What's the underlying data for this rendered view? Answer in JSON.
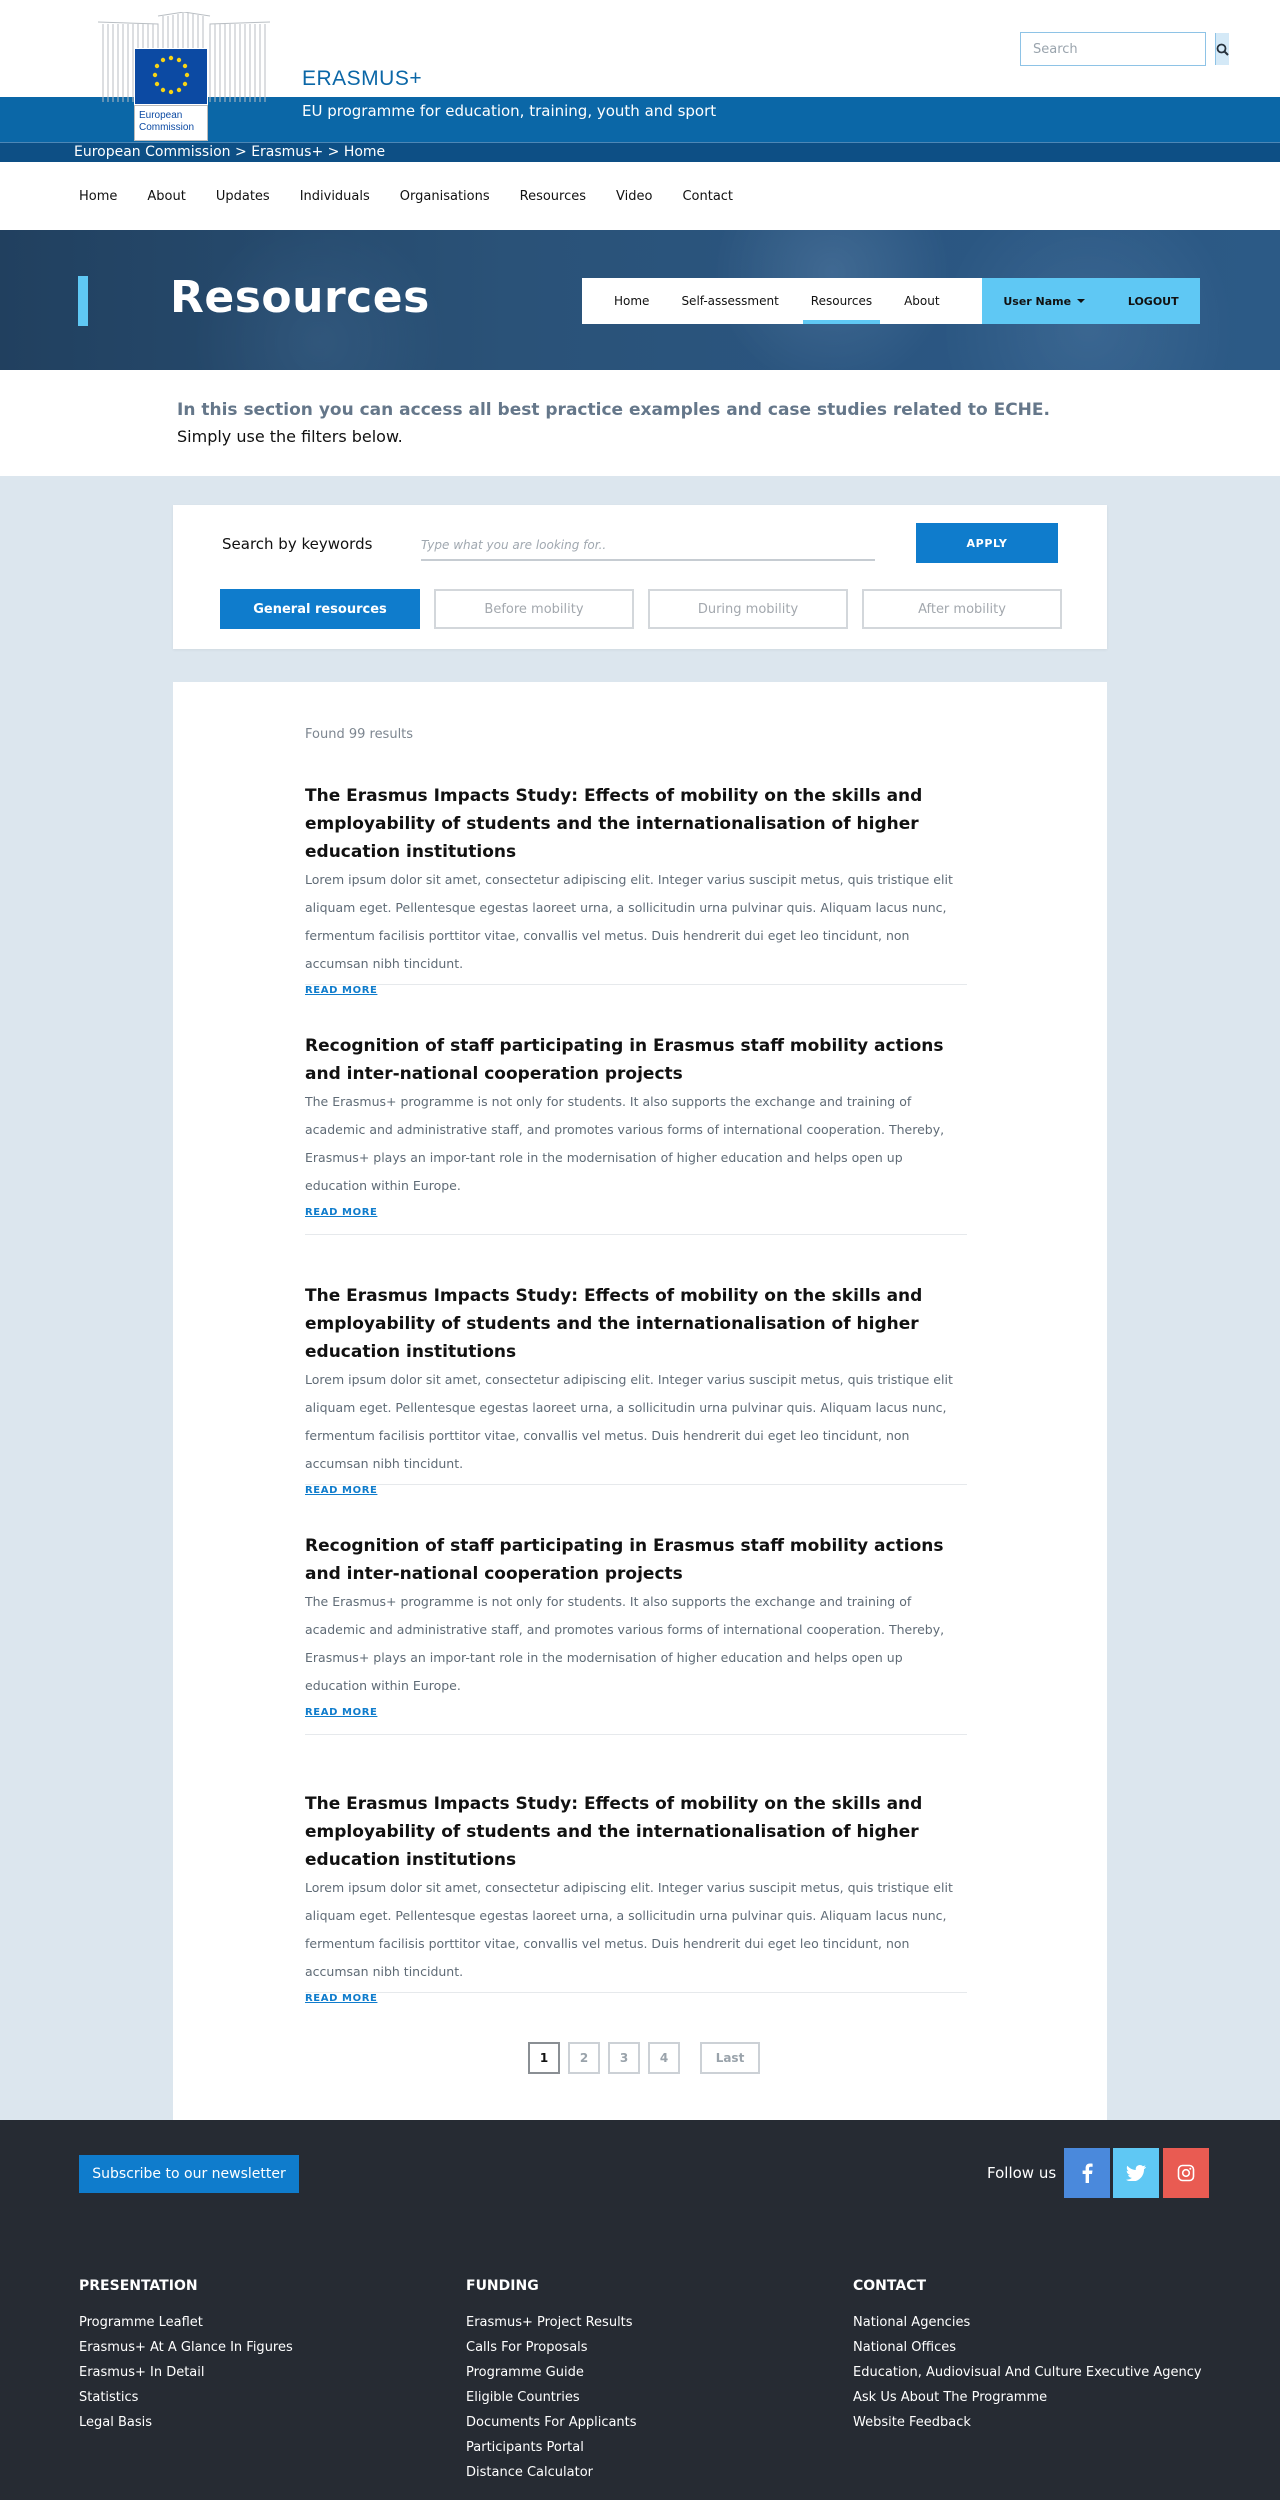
{
  "header": {
    "site_name": "ERASMUS+",
    "tagline": "EU programme for education, training, youth and sport",
    "logo_text": "European Commission",
    "search_placeholder": "Search",
    "breadcrumb": "European Commission > Erasmus+ > Home",
    "brand_blue": "#0b67a7"
  },
  "main_nav": [
    "Home",
    "About",
    "Updates",
    "Individuals",
    "Organisations",
    "Resources",
    "Video",
    "Contact"
  ],
  "hero": {
    "title": "Resources",
    "tabs": [
      "Home",
      "Self-assessment",
      "Resources",
      "About"
    ],
    "active_tab": "Resources",
    "user_name": "User Name",
    "logout": "LOGOUT",
    "accent": "#5fc8f4"
  },
  "intro": {
    "line1": "In this section you can access all best practice examples and case studies related to ECHE.",
    "line2": "Simply use the filters below."
  },
  "filters": {
    "label": "Search by keywords",
    "placeholder": "Type what you are looking for..",
    "apply": "APPLY",
    "tabs": [
      "General resources",
      "Before mobility",
      "During mobility",
      "After mobility"
    ],
    "active_tab": "General resources"
  },
  "results": {
    "found": "Found 99 results",
    "read_more": "READ MORE",
    "items": [
      {
        "title": "The Erasmus Impacts Study: Effects of mobility on the skills and employability of students and the internationalisation of higher education institutions",
        "text": "Lorem ipsum dolor sit amet, consectetur adipiscing elit. Integer varius suscipit metus, quis tristique elit aliquam eget. Pellentesque egestas laoreet urna, a sollicitudin urna pulvinar quis. Aliquam lacus nunc, fermentum facilisis porttitor vitae, convallis vel metus. Duis hendrerit dui eget leo tincidunt, non accumsan nibh tincidunt."
      },
      {
        "title": "Recognition of staff participating in Erasmus staff mobility actions and inter-national cooperation projects",
        "text": "The Erasmus+ programme is not only for students. It also supports the exchange and training of academic and administrative staff, and promotes various forms of international cooperation. Thereby, Erasmus+ plays an impor-tant role in the modernisation of higher education and helps open up education within Europe."
      },
      {
        "title": "The Erasmus Impacts Study: Effects of mobility on the skills and employability of students and the internationalisation of higher education institutions",
        "text": "Lorem ipsum dolor sit amet, consectetur adipiscing elit. Integer varius suscipit metus, quis tristique elit aliquam eget. Pellentesque egestas laoreet urna, a sollicitudin urna pulvinar quis. Aliquam lacus nunc, fermentum facilisis porttitor vitae, convallis vel metus. Duis hendrerit dui eget leo tincidunt, non accumsan nibh tincidunt."
      },
      {
        "title": "Recognition of staff participating in Erasmus staff mobility actions and inter-national cooperation projects",
        "text": "The Erasmus+ programme is not only for students. It also supports the exchange and training of academic and administrative staff, and promotes various forms of international cooperation. Thereby, Erasmus+ plays an impor-tant role in the modernisation of higher education and helps open up education within Europe."
      },
      {
        "title": "The Erasmus Impacts Study: Effects of mobility on the skills and employability of students and the internationalisation of higher education institutions",
        "text": "Lorem ipsum dolor sit amet, consectetur adipiscing elit. Integer varius suscipit metus, quis tristique elit aliquam eget. Pellentesque egestas laoreet urna, a sollicitudin urna pulvinar quis. Aliquam lacus nunc, fermentum facilisis porttitor vitae, convallis vel metus. Duis hendrerit dui eget leo tincidunt, non accumsan nibh tincidunt."
      }
    ]
  },
  "pagination": {
    "pages": [
      "1",
      "2",
      "3",
      "4"
    ],
    "current": "1",
    "last": "Last"
  },
  "footer": {
    "subscribe": "Subscribe to our newsletter",
    "follow": "Follow us",
    "social_icons": [
      "facebook-icon",
      "twitter-icon",
      "instagram-icon"
    ],
    "columns": [
      {
        "heading": "PRESENTATION",
        "links": [
          "Programme Leaflet",
          "Erasmus+ At A Glance In Figures",
          "Erasmus+ In Detail",
          "Statistics",
          "Legal Basis"
        ]
      },
      {
        "heading": "FUNDING",
        "links": [
          "Erasmus+ Project Results",
          "Calls For Proposals",
          "Programme Guide",
          "Eligible Countries",
          "Documents For Applicants",
          "Participants Portal",
          "Distance Calculator"
        ]
      },
      {
        "heading": "CONTACT",
        "links": [
          "National Agencies",
          "National Offices",
          "Education, Audiovisual And Culture Executive Agency",
          "Ask Us About The Programme",
          "Website Feedback"
        ]
      }
    ]
  }
}
